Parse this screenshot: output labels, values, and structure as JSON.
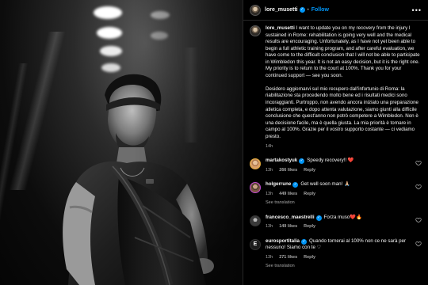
{
  "post": {
    "username": "lore_musetti",
    "follow_label": "Follow",
    "more_label": "•••",
    "caption_en": "I want to update you on my recovery from the injury I sustained in Rome: rehabilitation is going very well and the medical results are encouraging. Unfortunately, as I have not yet been able to begin a full athletic training program, and after careful evaluation, we have come to the difficult conclusion that I will not be able to participate in Wimbledon this year. It is not an easy decision, but it is the right one. My priority is to return to the court at 100%. Thank you for your continued support — see you soon.",
    "caption_it": "Desidero aggiornarvi sul mio recupero dall'infortunio di Roma: la riabilitazione sta procedendo molto bene ed i risultati medici sono incoraggianti. Purtroppo, non avendo ancora iniziato una preparazione atletica completa, e dopo attenta valutazione, siamo giunti alla difficile conclusione che quest'anno non potrò competere a Wimbledon. Non è una decisione facile, ma è quella giusta. La mia priorità è tornare in campo al 100%. Grazie per il vostro supporto costante — ci vediamo presto.",
    "time_ago": "14h"
  },
  "comments": [
    {
      "username": "martakostyuk",
      "text": "Speedy recovery!! ❤️",
      "time": "13h",
      "likes": "266 likes",
      "reply_label": "Reply",
      "see_translation": ""
    },
    {
      "username": "holgerrune",
      "text": "Get well soon man! 🙏🏼",
      "time": "13h",
      "likes": "449 likes",
      "reply_label": "Reply",
      "see_translation": "See translation"
    },
    {
      "username": "francesco_maestrelli",
      "text": "Forza muso❤️🔥",
      "time": "13h",
      "likes": "149 likes",
      "reply_label": "Reply",
      "see_translation": ""
    },
    {
      "username": "eurosportitalia",
      "text": "Quando tornerai al 100% non ce ne sarà per nessuno! Siamo con te ♡",
      "time": "13h",
      "likes": "271 likes",
      "reply_label": "Reply",
      "see_translation": "See translation"
    }
  ],
  "icons": {
    "verified": "verified-badge-icon",
    "heart": "heart-outline-icon",
    "more": "more-options-icon"
  },
  "colors": {
    "accent": "#0095f6",
    "text": "#f5f5f5",
    "muted": "#a8a8a8",
    "background": "#000000"
  }
}
